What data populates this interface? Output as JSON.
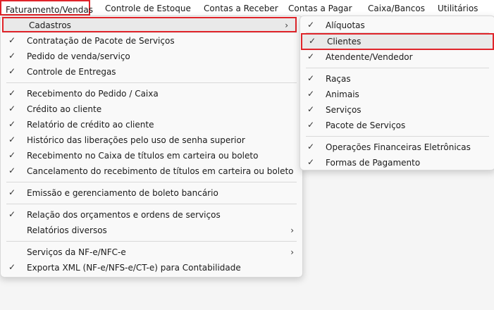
{
  "menubar": {
    "items": [
      {
        "label": "Faturamento/Vendas"
      },
      {
        "label": "Controle de Estoque"
      },
      {
        "label": "Contas a Receber"
      },
      {
        "label": "Contas a Pagar"
      },
      {
        "label": "Caixa/Bancos"
      },
      {
        "label": "Utilitários"
      }
    ]
  },
  "main_menu": {
    "items": [
      {
        "label": "Cadastros"
      },
      {
        "label": "Contratação de Pacote de Serviços"
      },
      {
        "label": "Pedido de venda/serviço"
      },
      {
        "label": "Controle de Entregas"
      },
      {
        "label": "Recebimento do Pedido / Caixa"
      },
      {
        "label": "Crédito ao cliente"
      },
      {
        "label": "Relatório de crédito ao cliente"
      },
      {
        "label": "Histórico das liberações pelo uso de senha superior"
      },
      {
        "label": "Recebimento no Caixa de títulos em carteira ou boleto"
      },
      {
        "label": "Cancelamento do recebimento de títulos em carteira ou boleto"
      },
      {
        "label": "Emissão e gerenciamento de boleto bancário"
      },
      {
        "label": "Relação dos orçamentos e ordens de serviços"
      },
      {
        "label": "Relatórios diversos"
      },
      {
        "label": "Serviços da NF-e/NFC-e"
      },
      {
        "label": "Exporta XML (NF-e/NFS-e/CT-e) para Contabilidade"
      }
    ]
  },
  "sub_menu": {
    "items": [
      {
        "label": "Alíquotas"
      },
      {
        "label": "Clientes"
      },
      {
        "label": "Atendente/Vendedor"
      },
      {
        "label": "Raças"
      },
      {
        "label": "Animais"
      },
      {
        "label": "Serviços"
      },
      {
        "label": "Pacote de Serviços"
      },
      {
        "label": "Operações Financeiras Eletrônicas"
      },
      {
        "label": "Formas de Pagamento"
      }
    ]
  },
  "glyphs": {
    "check": "✓",
    "arrow": "›"
  },
  "colors": {
    "highlight_border": "#e0242a",
    "hover_bg": "#e9e9e9"
  }
}
